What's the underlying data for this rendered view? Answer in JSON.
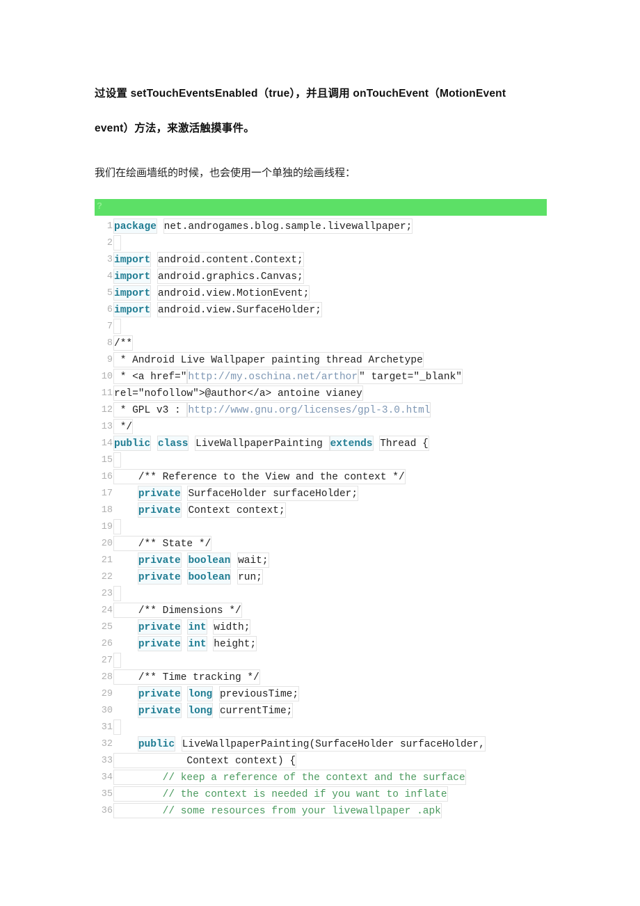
{
  "document": {
    "paragraphs": [
      {
        "id": "para-1",
        "style": "bold",
        "lines": [
          "过设置 setTouchEventsEnabled（true），并且调用 onTouchEvent（MotionEvent",
          "event）方法，来激活触摸事件。"
        ]
      },
      {
        "id": "para-2",
        "style": "normal",
        "lines": [
          "我们在绘画墙纸的时候，也会使用一个单独的绘画线程："
        ]
      }
    ],
    "code_block": {
      "toolbar": {
        "marker": "?",
        "background": "#5ce066",
        "marker_color": "#8ef08f"
      },
      "language": "java",
      "colors": {
        "keyword": "#1f7c92",
        "plain": "#222222",
        "link": "#7e97b4",
        "comment": "#4a9a5e",
        "line_number": "#b0b0b0",
        "token_border": "#e3e3e3"
      },
      "lines": [
        {
          "n": "1",
          "tokens": [
            {
              "t": "package",
              "c": "kw"
            },
            {
              "t": " ",
              "c": "gap"
            },
            {
              "t": "net.androgames.blog.sample.livewallpaper;",
              "c": "pl"
            }
          ]
        },
        {
          "n": "2",
          "tokens": [
            {
              "t": " ",
              "c": "blank"
            }
          ]
        },
        {
          "n": "3",
          "tokens": [
            {
              "t": "import",
              "c": "kw"
            },
            {
              "t": " ",
              "c": "gap"
            },
            {
              "t": "android.content.Context;",
              "c": "pl"
            }
          ]
        },
        {
          "n": "4",
          "tokens": [
            {
              "t": "import",
              "c": "kw"
            },
            {
              "t": " ",
              "c": "gap"
            },
            {
              "t": "android.graphics.Canvas;",
              "c": "pl"
            }
          ]
        },
        {
          "n": "5",
          "tokens": [
            {
              "t": "import",
              "c": "kw"
            },
            {
              "t": " ",
              "c": "gap"
            },
            {
              "t": "android.view.MotionEvent;",
              "c": "pl"
            }
          ]
        },
        {
          "n": "6",
          "tokens": [
            {
              "t": "import",
              "c": "kw"
            },
            {
              "t": " ",
              "c": "gap"
            },
            {
              "t": "android.view.SurfaceHolder;",
              "c": "pl"
            }
          ]
        },
        {
          "n": "7",
          "tokens": [
            {
              "t": " ",
              "c": "blank"
            }
          ]
        },
        {
          "n": "8",
          "tokens": [
            {
              "t": "/**",
              "c": "cmt-d"
            }
          ]
        },
        {
          "n": "9",
          "tokens": [
            {
              "t": " * Android Live Wallpaper painting thread Archetype",
              "c": "cmt-d"
            }
          ]
        },
        {
          "n": "10",
          "tokens": [
            {
              "t": " * <a href=\"",
              "c": "cmt-d"
            },
            {
              "t": "http://my.oschina.net/arthor",
              "c": "lnk"
            },
            {
              "t": "\" target=\"_blank\"",
              "c": "cmt-d"
            }
          ]
        },
        {
          "n": "11",
          "tokens": [
            {
              "t": "rel=\"nofollow\">@author</a> antoine vianey",
              "c": "cmt-d"
            }
          ]
        },
        {
          "n": "12",
          "tokens": [
            {
              "t": " * GPL v3 : ",
              "c": "cmt-d"
            },
            {
              "t": "http://www.gnu.org/licenses/gpl-3.0.html",
              "c": "lnk"
            }
          ]
        },
        {
          "n": "13",
          "tokens": [
            {
              "t": " */",
              "c": "cmt-d"
            }
          ]
        },
        {
          "n": "14",
          "tokens": [
            {
              "t": "public",
              "c": "kw"
            },
            {
              "t": " ",
              "c": "gap"
            },
            {
              "t": "class",
              "c": "kw"
            },
            {
              "t": " ",
              "c": "gap"
            },
            {
              "t": "LiveWallpaperPainting ",
              "c": "pl"
            },
            {
              "t": "extends",
              "c": "kw"
            },
            {
              "t": " ",
              "c": "gap"
            },
            {
              "t": "Thread {",
              "c": "pl"
            }
          ]
        },
        {
          "n": "15",
          "tokens": [
            {
              "t": " ",
              "c": "blank"
            }
          ]
        },
        {
          "n": "16",
          "tokens": [
            {
              "t": "    /** Reference to the View and the context */",
              "c": "cmt-d"
            }
          ]
        },
        {
          "n": "17",
          "tokens": [
            {
              "t": "    ",
              "c": "gap"
            },
            {
              "t": "private",
              "c": "kw"
            },
            {
              "t": " ",
              "c": "gap"
            },
            {
              "t": "SurfaceHolder surfaceHolder;",
              "c": "pl"
            }
          ]
        },
        {
          "n": "18",
          "tokens": [
            {
              "t": "    ",
              "c": "gap"
            },
            {
              "t": "private",
              "c": "kw"
            },
            {
              "t": " ",
              "c": "gap"
            },
            {
              "t": "Context context;",
              "c": "pl"
            }
          ]
        },
        {
          "n": "19",
          "tokens": [
            {
              "t": " ",
              "c": "blank"
            }
          ]
        },
        {
          "n": "20",
          "tokens": [
            {
              "t": "    /** State */",
              "c": "cmt-d"
            }
          ]
        },
        {
          "n": "21",
          "tokens": [
            {
              "t": "    ",
              "c": "gap"
            },
            {
              "t": "private",
              "c": "kw"
            },
            {
              "t": " ",
              "c": "gap"
            },
            {
              "t": "boolean",
              "c": "kw"
            },
            {
              "t": " ",
              "c": "gap"
            },
            {
              "t": "wait;",
              "c": "pl"
            }
          ]
        },
        {
          "n": "22",
          "tokens": [
            {
              "t": "    ",
              "c": "gap"
            },
            {
              "t": "private",
              "c": "kw"
            },
            {
              "t": " ",
              "c": "gap"
            },
            {
              "t": "boolean",
              "c": "kw"
            },
            {
              "t": " ",
              "c": "gap"
            },
            {
              "t": "run;",
              "c": "pl"
            }
          ]
        },
        {
          "n": "23",
          "tokens": [
            {
              "t": " ",
              "c": "blank"
            }
          ]
        },
        {
          "n": "24",
          "tokens": [
            {
              "t": "    /** Dimensions */",
              "c": "cmt-d"
            }
          ]
        },
        {
          "n": "25",
          "tokens": [
            {
              "t": "    ",
              "c": "gap"
            },
            {
              "t": "private",
              "c": "kw"
            },
            {
              "t": " ",
              "c": "gap"
            },
            {
              "t": "int",
              "c": "kw"
            },
            {
              "t": " ",
              "c": "gap"
            },
            {
              "t": "width;",
              "c": "pl"
            }
          ]
        },
        {
          "n": "26",
          "tokens": [
            {
              "t": "    ",
              "c": "gap"
            },
            {
              "t": "private",
              "c": "kw"
            },
            {
              "t": " ",
              "c": "gap"
            },
            {
              "t": "int",
              "c": "kw"
            },
            {
              "t": " ",
              "c": "gap"
            },
            {
              "t": "height;",
              "c": "pl"
            }
          ]
        },
        {
          "n": "27",
          "tokens": [
            {
              "t": " ",
              "c": "blank"
            }
          ]
        },
        {
          "n": "28",
          "tokens": [
            {
              "t": "    /** Time tracking */",
              "c": "cmt-d"
            }
          ]
        },
        {
          "n": "29",
          "tokens": [
            {
              "t": "    ",
              "c": "gap"
            },
            {
              "t": "private",
              "c": "kw"
            },
            {
              "t": " ",
              "c": "gap"
            },
            {
              "t": "long",
              "c": "kw"
            },
            {
              "t": " ",
              "c": "gap"
            },
            {
              "t": "previousTime;",
              "c": "pl"
            }
          ]
        },
        {
          "n": "30",
          "tokens": [
            {
              "t": "    ",
              "c": "gap"
            },
            {
              "t": "private",
              "c": "kw"
            },
            {
              "t": " ",
              "c": "gap"
            },
            {
              "t": "long",
              "c": "kw"
            },
            {
              "t": " ",
              "c": "gap"
            },
            {
              "t": "currentTime;",
              "c": "pl"
            }
          ]
        },
        {
          "n": "31",
          "tokens": [
            {
              "t": " ",
              "c": "blank"
            }
          ]
        },
        {
          "n": "32",
          "tokens": [
            {
              "t": "    ",
              "c": "gap"
            },
            {
              "t": "public",
              "c": "kw"
            },
            {
              "t": " ",
              "c": "gap"
            },
            {
              "t": "LiveWallpaperPainting(SurfaceHolder surfaceHolder,",
              "c": "pl"
            }
          ]
        },
        {
          "n": "33",
          "tokens": [
            {
              "t": "            Context context) {",
              "c": "pl"
            }
          ]
        },
        {
          "n": "34",
          "tokens": [
            {
              "t": "        // keep a reference of the context and the surface",
              "c": "cmt"
            }
          ]
        },
        {
          "n": "35",
          "tokens": [
            {
              "t": "        // the context is needed if you want to inflate",
              "c": "cmt"
            }
          ]
        },
        {
          "n": "36",
          "tokens": [
            {
              "t": "        // some resources from your livewallpaper .apk",
              "c": "cmt"
            }
          ]
        }
      ]
    }
  }
}
